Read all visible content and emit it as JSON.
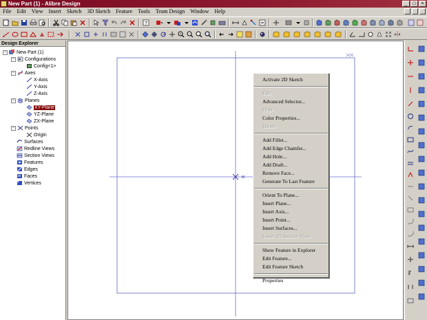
{
  "window": {
    "title": "New Part (1) - Alibre Design",
    "minimize": "_",
    "maximize": "□",
    "close": "×"
  },
  "menubar": {
    "items": [
      "File",
      "Edit",
      "View",
      "Insert",
      "Sketch",
      "3D Sketch",
      "Feature",
      "Tools",
      "Team Design",
      "Window",
      "Help"
    ]
  },
  "explorer": {
    "header": "Design Explorer",
    "root": "New Part (1)",
    "configurations": "Configurations",
    "config1": "Config<1>",
    "axes": "Axes",
    "x_axis": "X-Axis",
    "y_axis": "Y-Axis",
    "z_axis": "Z-Axis",
    "planes": "Planes",
    "xy_plane": "XY-Plane",
    "yz_plane": "YZ-Plane",
    "zx_plane": "ZX-Plane",
    "points": "Points",
    "origin": "Origin",
    "surfaces": "Surfaces",
    "redline_views": "Redline Views",
    "section_views": "Section Views",
    "features": "Features",
    "edges": "Edges",
    "faces": "Faces",
    "vertices": "Vertices"
  },
  "context_menu": {
    "activate_2d_sketch": "Activate 2D Sketch",
    "edit": "Edit",
    "advanced_selector": "Advanced Selector...",
    "hide": "Hide",
    "color_properties": "Color Properties...",
    "delete": "Delete",
    "add_fillet": "Add Fillet...",
    "add_edge_chamfer": "Add Edge Chamfer...",
    "add_hole": "Add Hole...",
    "add_draft": "Add Draft...",
    "remove_face": "Remove Face...",
    "generate_to_last_feature": "Generate To Last Feature",
    "orient_to_plane": "Orient To Plane...",
    "insert_plane": "Insert Plane...",
    "insert_axis": "Insert Axis...",
    "insert_point": "Insert Point...",
    "insert_surfaces": "Insert Surfaces...",
    "insert_3d_section_view": "Insert 3D Section View",
    "show_feature_in_explorer": "Show Feature in Explorer",
    "edit_feature": "Edit Feature...",
    "edit_feature_sketch": "Edit Feature Sketch",
    "properties": "Properties"
  },
  "colors": {
    "titlebar": "#7a0a22",
    "selection": "#800000",
    "plane_outline": "#7a84c8",
    "axis_line": "#6a6ad0"
  }
}
